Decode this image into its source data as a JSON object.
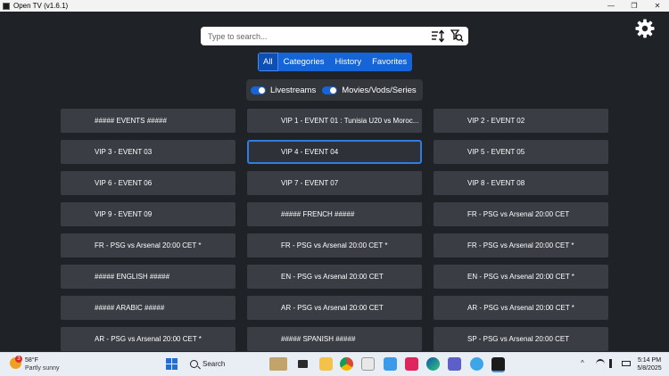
{
  "window": {
    "title": "Open TV (v1.6.1)",
    "controls": [
      "—",
      "❐",
      "✕"
    ]
  },
  "search": {
    "placeholder": "Type to search..."
  },
  "tabs": [
    {
      "label": "All",
      "active": true
    },
    {
      "label": "Categories",
      "active": false
    },
    {
      "label": "History",
      "active": false
    },
    {
      "label": "Favorites",
      "active": false
    }
  ],
  "toggles": [
    {
      "label": "Livestreams",
      "on": true
    },
    {
      "label": "Movies/Vods/Series",
      "on": true
    }
  ],
  "channels": [
    "##### EVENTS #####",
    "VIP 1 - EVENT 01 : Tunisia U20 vs Moroc...",
    "VIP 2 - EVENT 02",
    "VIP 3 - EVENT 03",
    "VIP 4 - EVENT 04",
    "VIP 5 - EVENT 05",
    "VIP 6 - EVENT 06",
    "VIP 7 - EVENT 07",
    "VIP 8 - EVENT 08",
    "VIP 9 - EVENT 09",
    "##### FRENCH #####",
    "FR - PSG vs Arsenal 20:00 CET",
    "FR - PSG vs Arsenal 20:00 CET *",
    "FR - PSG vs Arsenal 20:00 CET *",
    "FR - PSG vs Arsenal 20:00 CET *",
    "##### ENGLISH #####",
    "EN - PSG vs Arsenal 20:00 CET",
    "EN - PSG vs Arsenal 20:00 CET *",
    "##### ARABIC #####",
    "AR - PSG vs Arsenal 20:00 CET",
    "AR - PSG vs Arsenal 20:00 CET *",
    "AR - PSG vs Arsenal 20:00 CET *",
    "##### SPANISH #####",
    "SP - PSG vs Arsenal 20:00 CET"
  ],
  "selected_channel": "VIP 4 - EVENT 04",
  "taskbar": {
    "weather_badge": "3",
    "temperature": "58°F",
    "condition": "Partly sunny",
    "search_label": "Search",
    "time": "5:14 PM",
    "date": "5/8/2025"
  },
  "colors": {
    "background": "#1f2226",
    "card": "#3a3e44",
    "accent": "#1565d8",
    "selected_border": "#2f7de0"
  }
}
